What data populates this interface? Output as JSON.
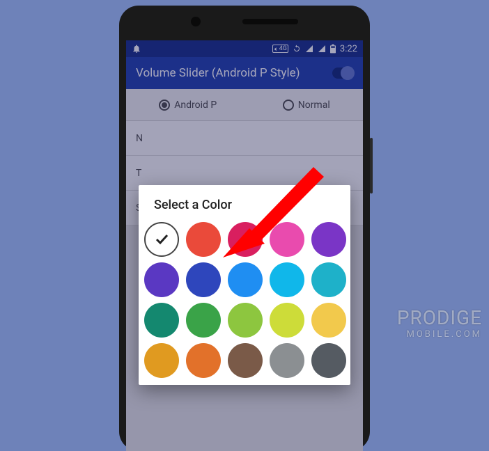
{
  "statusbar": {
    "network_label": "4G",
    "time": "3:22"
  },
  "appbar": {
    "title": "Volume Slider (Android P Style)"
  },
  "tabs": {
    "tab1": "Android P",
    "tab2": "Normal"
  },
  "rows": {
    "r1": "N",
    "r2": "T",
    "r3": "S"
  },
  "dialog": {
    "title": "Select a Color"
  },
  "colors": {
    "row1": [
      "#ffffff",
      "#ea4a3a",
      "#d91f5f",
      "#e94bae",
      "#7a35c6"
    ],
    "row2": [
      "#5a38c2",
      "#2e46bc",
      "#1f8ef2",
      "#10b7ea",
      "#1eb1c9"
    ],
    "row3": [
      "#14886f",
      "#3aa348",
      "#8dc63f",
      "#cddc39",
      "#f2c94c"
    ],
    "row4": [
      "#e09a20",
      "#e2712a",
      "#7a5a48",
      "#8b8f92",
      "#555b62"
    ]
  },
  "selected_color_index": "0",
  "watermark": {
    "main": "PRODIGE",
    "sub": "MOBILE.COM"
  }
}
